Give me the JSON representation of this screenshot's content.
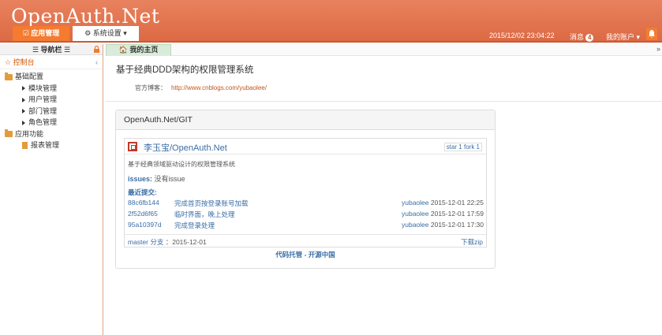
{
  "header": {
    "logo": "OpenAuth.Net",
    "menu_app": "☑ 应用管理",
    "menu_sys": "⚙ 系统设置 ▾",
    "datetime": "2015/12/02 23:04:22",
    "messages_label": "消息",
    "messages_count": "4",
    "account_label": "我的账户 ▾",
    "bell_icon": "bell-icon"
  },
  "sidebar": {
    "title": "☰ 导航栏 ☰",
    "control": "☆ 控制台",
    "groups": [
      {
        "label": "基础配置",
        "items": [
          "模块管理",
          "用户管理",
          "部门管理",
          "角色管理"
        ]
      },
      {
        "label": "应用功能",
        "items": [
          "报表管理"
        ]
      }
    ]
  },
  "tabs": [
    {
      "label": "🏠 我的主页"
    }
  ],
  "main": {
    "title": "基于经典DDD架构的权限管理系统",
    "blog_label": "官方博客：",
    "blog_url": "http://www.cnblogs.com/yubaolee/",
    "panel_title": "OpenAuth.Net/GIT",
    "repo": {
      "name": "李玉宝/OpenAuth.Net",
      "stats": "star 1  fork 1",
      "description": "基于经典领域驱动设计的权限管理系统",
      "issues_label": "issues:",
      "issues_value": " 没有issue",
      "recent_label": "最近提交:",
      "commits": [
        {
          "sha": "88c6fb144",
          "message": "完成首页按登录账号加载",
          "author": "yubaolee",
          "date": "2015-12-01 22:25"
        },
        {
          "sha": "2f52d6f65",
          "message": "临时界面，晚上处理",
          "author": "yubaolee",
          "date": "2015-12-01 17:59"
        },
        {
          "sha": "95a10397d",
          "message": "完成登录处理",
          "author": "yubaolee",
          "date": "2015-12-01 17:30"
        }
      ],
      "branch_label": "master 分支",
      "branch_date": "：2015-12-01",
      "download": "下载zip"
    },
    "hosted": "代码托管 - 开源中国"
  }
}
